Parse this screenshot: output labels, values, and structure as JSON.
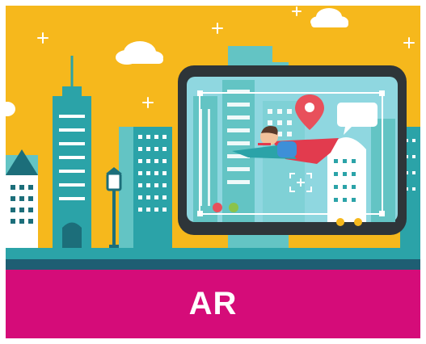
{
  "colors": {
    "sky": "#F6B81C",
    "building_teal": "#2BA3A8",
    "building_light": "#63C4C4",
    "building_dark": "#1C6E7A",
    "ground": "#1E5E73",
    "banner": "#D50C79",
    "device_frame": "#2E3539",
    "screen_tint": "#8FD7E0",
    "pin_red": "#E8505B",
    "cape_red": "#E23B4E",
    "white": "#FFFFFF"
  },
  "icons": [
    "sparkle-icon",
    "cloud-icon",
    "location-pin-icon",
    "speech-bubble-icon",
    "focus-target-icon",
    "street-lamp-icon"
  ],
  "banner": {
    "label": "AR"
  }
}
